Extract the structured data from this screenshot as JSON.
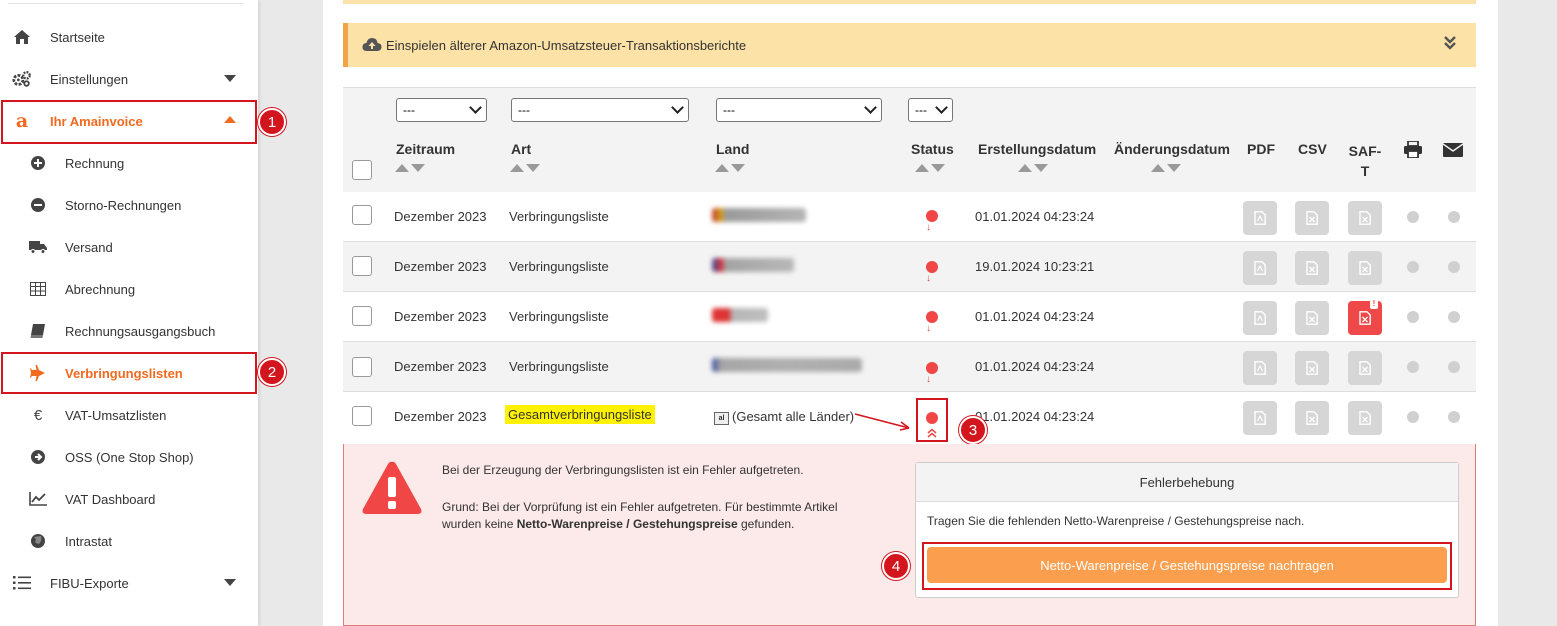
{
  "sidebar": {
    "items": [
      {
        "label": "Startseite",
        "icon": "home-icon"
      },
      {
        "label": "Einstellungen",
        "icon": "gears-icon"
      },
      {
        "label": "Ihr Amainvoice",
        "icon": "amazon-icon"
      },
      {
        "label": "Rechnung",
        "icon": "plus-circle-icon"
      },
      {
        "label": "Storno-Rechnungen",
        "icon": "minus-circle-icon"
      },
      {
        "label": "Versand",
        "icon": "truck-icon"
      },
      {
        "label": "Abrechnung",
        "icon": "table-icon"
      },
      {
        "label": "Rechnungsausgangsbuch",
        "icon": "book-icon"
      },
      {
        "label": "Verbringungslisten",
        "icon": "plane-icon"
      },
      {
        "label": "VAT-Umsatzlisten",
        "icon": "euro-icon"
      },
      {
        "label": "OSS (One Stop Shop)",
        "icon": "arrow-circle-icon"
      },
      {
        "label": "VAT Dashboard",
        "icon": "chart-line-icon"
      },
      {
        "label": "Intrastat",
        "icon": "globe-icon"
      },
      {
        "label": "FIBU-Exporte",
        "icon": "list-icon"
      }
    ]
  },
  "markers": [
    "1",
    "2",
    "3",
    "4"
  ],
  "panel": {
    "text": "Einspielen älterer Amazon-Umsatzsteuer-Transaktionsberichte"
  },
  "filters": {
    "zeitraum": "---",
    "art": "---",
    "land": "---",
    "status": "---"
  },
  "columns": {
    "zeitraum": "Zeitraum",
    "art": "Art",
    "land": "Land",
    "status": "Status",
    "erstellungsdatum": "Erstellungsdatum",
    "aenderungsdatum": "Änderungsdatum",
    "pdf": "PDF",
    "csv": "CSV",
    "saft": "SAF-T"
  },
  "rows": [
    {
      "zeitraum": "Dezember 2023",
      "art": "Verbringungsliste",
      "erstellt": "01.01.2024 04:23:24"
    },
    {
      "zeitraum": "Dezember 2023",
      "art": "Verbringungsliste",
      "erstellt": "19.01.2024 10:23:21"
    },
    {
      "zeitraum": "Dezember 2023",
      "art": "Verbringungsliste",
      "erstellt": "01.01.2024 04:23:24"
    },
    {
      "zeitraum": "Dezember 2023",
      "art": "Verbringungsliste",
      "erstellt": "01.01.2024 04:23:24"
    },
    {
      "zeitraum": "Dezember 2023",
      "art": "Gesamtverbringungsliste",
      "land": "(Gesamt alle Länder)",
      "erstellt": "01.01.2024 04:23:24"
    }
  ],
  "error": {
    "line1": "Bei der Erzeugung der Verbringungslisten ist ein Fehler aufgetreten.",
    "line2": "Grund: Bei der Vorprüfung ist ein Fehler aufgetreten. Für bestimmte Artikel",
    "line3_pre": "wurden keine ",
    "line3_bold": "Netto-Warenpreise / Gestehungspreise",
    "line3_post": " gefunden.",
    "fix_title": "Fehlerbehebung",
    "fix_text": "Tragen Sie die fehlenden Netto-Warenpreise / Gestehungspreise nach.",
    "fix_button": "Netto-Warenpreise / Gestehungspreise nachtragen"
  },
  "colors": {
    "accent": "#f26a20",
    "marker": "#d3161e",
    "status_error": "#f04646",
    "button": "#fb9f4e"
  }
}
